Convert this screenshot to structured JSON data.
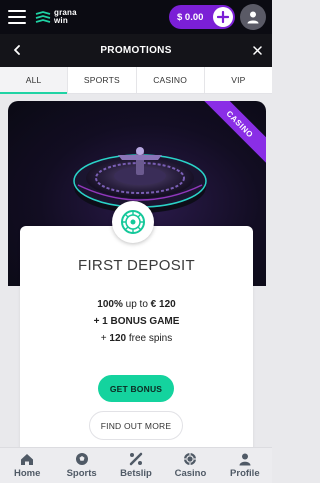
{
  "brand": {
    "logo_line1": "grana",
    "logo_line2": "win"
  },
  "header": {
    "balance": "$ 0.00"
  },
  "promobar": {
    "title": "PROMOTIONS"
  },
  "tabs": [
    {
      "label": "ALL",
      "active": true
    },
    {
      "label": "SPORTS"
    },
    {
      "label": "CASINO"
    },
    {
      "label": "VIP"
    }
  ],
  "promo": {
    "ribbon": "CASINO",
    "title": "FIRST DEPOSIT",
    "line1_bold": "100%",
    "line1_rest": " up to ",
    "line1_amount": "€ 120",
    "line2": "+ 1 BONUS GAME",
    "line3_prefix": "+ ",
    "line3_bold": "120",
    "line3_rest": " free spins",
    "get_bonus": "GET BONUS",
    "find_out_more": "FIND OUT MORE"
  },
  "bottom_nav": [
    {
      "label": "Home",
      "icon": "home-icon"
    },
    {
      "label": "Sports",
      "icon": "soccer-ball-icon"
    },
    {
      "label": "Betslip",
      "icon": "betslip-icon"
    },
    {
      "label": "Casino",
      "icon": "casino-chip-icon"
    },
    {
      "label": "Profile",
      "icon": "profile-icon"
    }
  ],
  "colors": {
    "accent": "#1fd3a4",
    "balance_pill": "#7b1fd6",
    "ribbon": "#8a2ee6"
  }
}
